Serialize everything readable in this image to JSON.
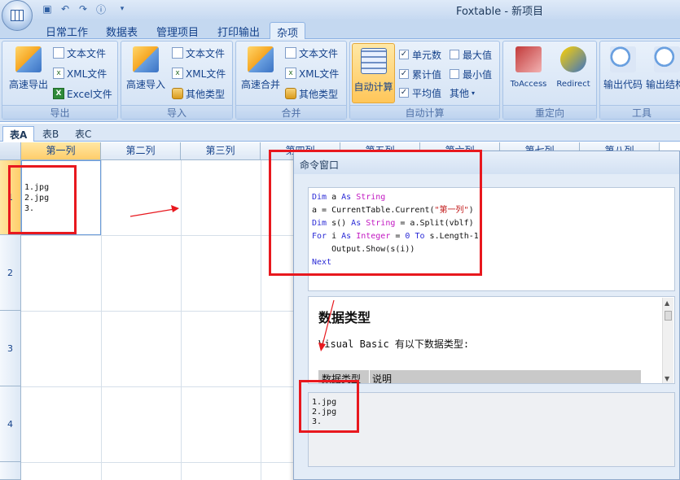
{
  "title_bar": {
    "app_title": "Foxtable - 新项目"
  },
  "ribbon_tabs": [
    {
      "label": "日常工作"
    },
    {
      "label": "数据表"
    },
    {
      "label": "管理项目"
    },
    {
      "label": "打印输出"
    },
    {
      "label": "杂项"
    }
  ],
  "groups": {
    "export": {
      "label": "导出",
      "big": "高速导出",
      "items": [
        "文本文件",
        "XML文件",
        "Excel文件"
      ]
    },
    "import": {
      "label": "导入",
      "big": "高速导入",
      "items": [
        "文本文件",
        "XML文件",
        "其他类型"
      ]
    },
    "merge": {
      "label": "合并",
      "big": "高速合并",
      "items": [
        "文本文件",
        "XML文件",
        "其他类型"
      ]
    },
    "auto_calc": {
      "label": "自动计算",
      "big": "自动计算",
      "checks": [
        {
          "label": "单元数",
          "checked": true
        },
        {
          "label": "最大值",
          "checked": false
        },
        {
          "label": "累计值",
          "checked": true
        },
        {
          "label": "最小值",
          "checked": false
        },
        {
          "label": "平均值",
          "checked": true
        }
      ],
      "other": "其他"
    },
    "redirect": {
      "label": "重定向",
      "buttons": [
        "ToAccess",
        "Redirect"
      ]
    },
    "tools": {
      "label": "工具",
      "buttons": [
        "输出代码",
        "输出结构"
      ]
    }
  },
  "sheet_tabs": [
    "表A",
    "表B",
    "表C"
  ],
  "grid": {
    "columns": [
      "第一列",
      "第二列",
      "第三列",
      "第四列",
      "第五列",
      "第六列",
      "第七列",
      "第八列"
    ],
    "rows": [
      "1",
      "2",
      "3",
      "4"
    ],
    "cell_a1": "1.jpg\n2.jpg\n3."
  },
  "command_window": {
    "title": "命令窗口",
    "code_lines": [
      "Dim a As String",
      "a = CurrentTable.Current(\"第一列\")",
      "Dim s() As String = a.Split(vblf)",
      "For i As Integer = 0 To s.Length-1",
      "    Output.Show(s(i))",
      "Next"
    ],
    "help": {
      "heading": "数据类型",
      "body": "Visual Basic 有以下数据类型:",
      "table_headers": [
        "数据类型",
        "说明"
      ]
    },
    "output": "1.jpg\n2.jpg\n3."
  },
  "colors": {
    "accent": "#ffc659",
    "annotation": "#e8181e"
  }
}
